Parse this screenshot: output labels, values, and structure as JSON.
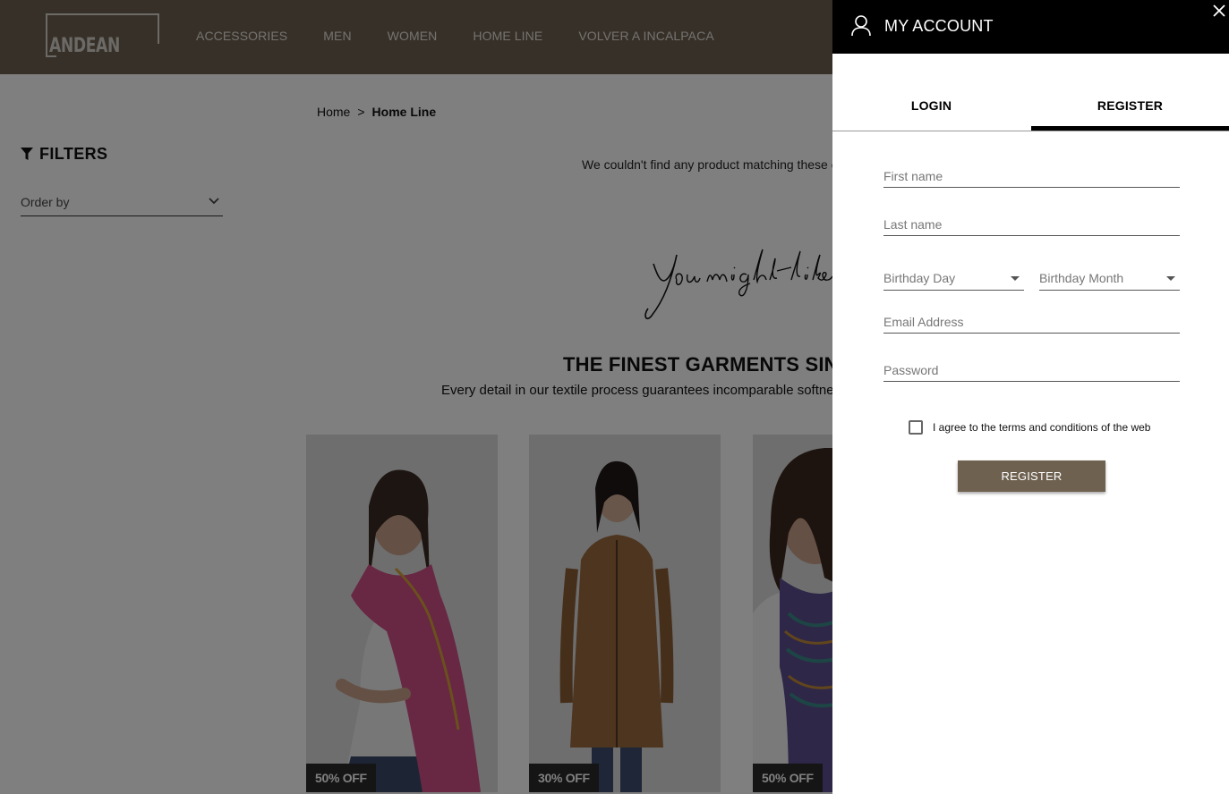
{
  "header": {
    "logo_text": "ANDEAN",
    "nav": [
      "ACCESSORIES",
      "MEN",
      "WOMEN",
      "HOME LINE",
      "VOLVER A INCALPACA"
    ]
  },
  "breadcrumb": {
    "home": "Home",
    "separator": ">",
    "current": "Home Line"
  },
  "filters": {
    "label": "FILTERS",
    "order_by": "Order by"
  },
  "results": {
    "empty_message": "We couldn't find any product matching these c",
    "recommend_script": "You might like"
  },
  "promo": {
    "title": "THE FINEST GARMENTS SINC",
    "subtitle": "Every detail in our textile process guarantees incomparable softness,"
  },
  "products": [
    {
      "badge": "50% OFF",
      "garment_color": "#c8477c"
    },
    {
      "badge": "30% OFF",
      "garment_color": "#8a5a34"
    },
    {
      "badge": "50% OFF",
      "garment_color": "#5a4d8c"
    }
  ],
  "account_drawer": {
    "title": "MY ACCOUNT",
    "tabs": {
      "login": "LOGIN",
      "register": "REGISTER",
      "active": "register"
    },
    "fields": {
      "first_name": "First name",
      "last_name": "Last name",
      "birthday_day": "Birthday Day",
      "birthday_month": "Birthday Month",
      "email": "Email Address",
      "password": "Password"
    },
    "terms_label": "I agree to the terms and conditions of the web",
    "terms_checked": false,
    "submit_label": "REGISTER"
  },
  "colors": {
    "brand": "#6e6150",
    "drawer_header": "#000000",
    "overlay": "rgba(0,0,0,0.5)"
  }
}
